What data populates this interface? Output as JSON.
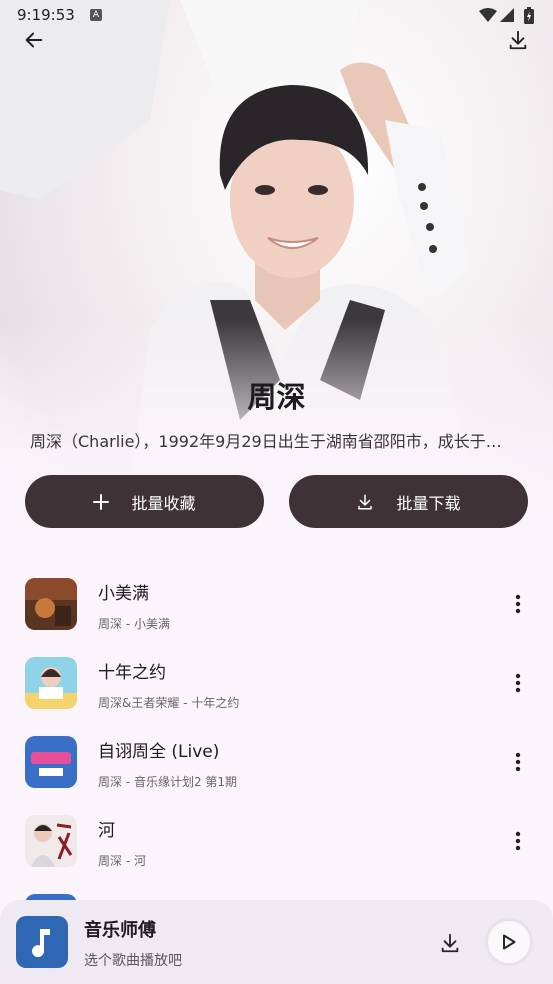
{
  "status_bar": {
    "time": "9:19:53",
    "indicator": "A"
  },
  "artist": {
    "name": "周深",
    "description": "周深（Charlie），1992年9月29日出生于湖南省邵阳市，成长于…"
  },
  "actions": {
    "collect_label": "批量收藏",
    "download_label": "批量下载"
  },
  "songs": [
    {
      "title": "小美满",
      "subtitle": "周深 - 小美满"
    },
    {
      "title": "十年之约",
      "subtitle": "周深&王者荣耀 - 十年之约"
    },
    {
      "title": "自诩周全 (Live)",
      "subtitle": "周深 - 音乐缘计划2 第1期"
    },
    {
      "title": "河",
      "subtitle": "周深 - 河"
    }
  ],
  "player": {
    "title": "音乐师傅",
    "subtitle": "选个歌曲播放吧"
  },
  "icons": {
    "back": "arrow-left-icon",
    "download": "download-icon",
    "add": "plus-icon",
    "more": "more-vert-icon",
    "music_note": "music-note-icon",
    "play": "play-icon"
  },
  "colors": {
    "button_bg": "#3f3236",
    "page_bg": "#fbf5fb",
    "player_bg": "#efe9f1",
    "player_art": "#2f67b3"
  }
}
